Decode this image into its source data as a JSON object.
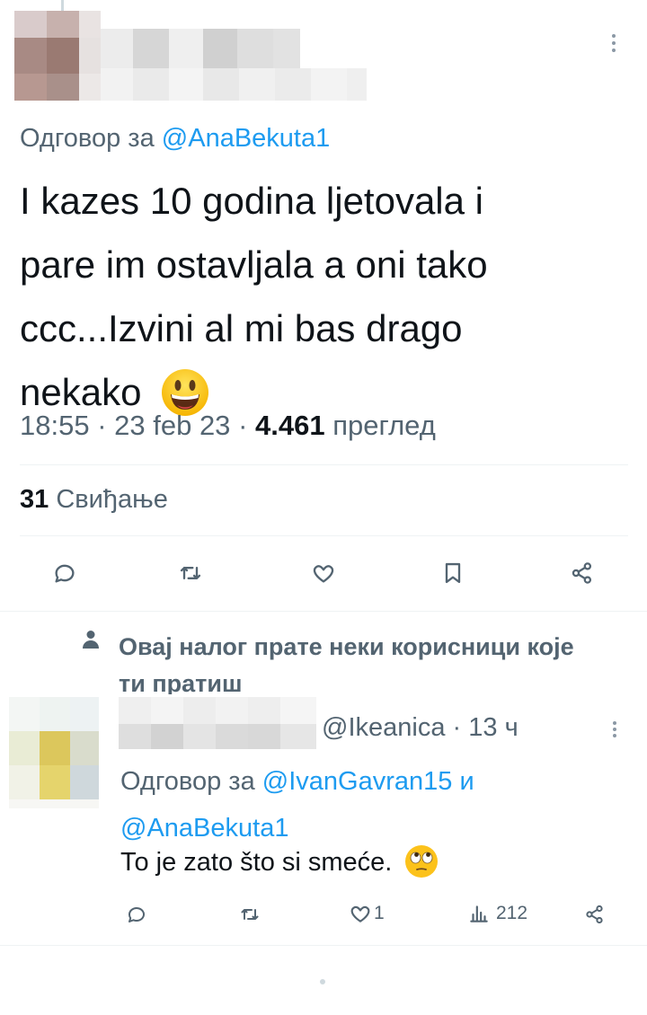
{
  "main_tweet": {
    "reply_prefix": "Одговор за",
    "reply_to": "@AnaBekuta1",
    "text_lines": [
      "I kazes 10 godina ljetovala i",
      "pare im ostavljala a oni tako",
      "ccc...Izvini al mi bas drago",
      "nekako"
    ],
    "emoji": "grinning-face-emoji",
    "time": "18:55",
    "date": "23 feb 23",
    "views_count": "4.461",
    "views_label": "преглед",
    "likes_count": "31",
    "likes_label": "Свиђање"
  },
  "actions": [
    "reply-icon",
    "retweet-icon",
    "like-icon",
    "bookmark-icon",
    "share-icon"
  ],
  "social_context": {
    "text_line1": "Овај налог прате неки корисници које",
    "text_line2": "ти пратиш"
  },
  "reply_tweet": {
    "handle": "@Ikeanica",
    "dot": "·",
    "age": "13 ч",
    "reply_prefix": "Одговор за",
    "reply_to_1": "@IvanGavran15",
    "and": "и",
    "reply_to_2": "@AnaBekuta1",
    "text": "То je zato što si smeće.",
    "emoji": "face-with-rolling-eyes-emoji",
    "like_count": "1",
    "views_count": "212"
  },
  "colors": {
    "accent": "#1d9bf0",
    "muted": "#536471",
    "divider": "#eff3f4"
  }
}
